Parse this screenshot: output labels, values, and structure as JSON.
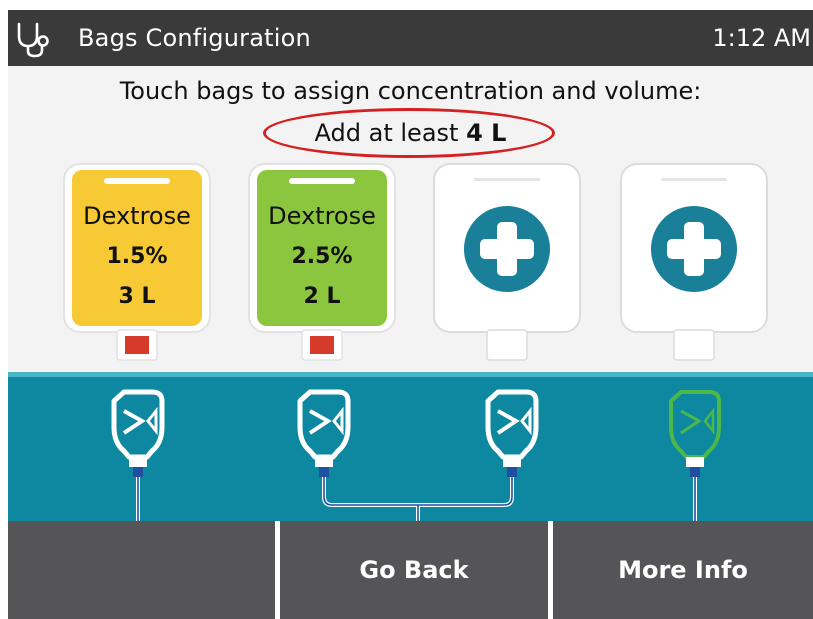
{
  "header": {
    "title": "Bags Configuration",
    "time": "1:12 AM",
    "icon": "stethoscope-icon"
  },
  "instructions": "Touch bags to assign concentration and volume:",
  "requirement": {
    "prefix": "Add at least",
    "amount": "4 L"
  },
  "bags": [
    {
      "type": "Dextrose",
      "concentration": "1.5%",
      "volume": "3 L",
      "color": "#f7c934",
      "state": "filled"
    },
    {
      "type": "Dextrose",
      "concentration": "2.5%",
      "volume": "2 L",
      "color": "#8cc63f",
      "state": "filled"
    },
    {
      "state": "empty",
      "icon": "add-icon"
    },
    {
      "state": "empty",
      "icon": "add-icon"
    }
  ],
  "connectors": [
    {
      "color": "#ffffff"
    },
    {
      "color": "#ffffff"
    },
    {
      "color": "#ffffff"
    },
    {
      "color": "#4cb848"
    }
  ],
  "buttons": [
    {
      "label": ""
    },
    {
      "label": "Go Back"
    },
    {
      "label": "More Info"
    }
  ],
  "colors": {
    "header_bg": "#3a3a3a",
    "teal": "#0e88a0",
    "plus_teal": "#1a7f99",
    "button_bg": "#555557",
    "annotation": "#d42020",
    "port_red": "#d63a2a"
  }
}
